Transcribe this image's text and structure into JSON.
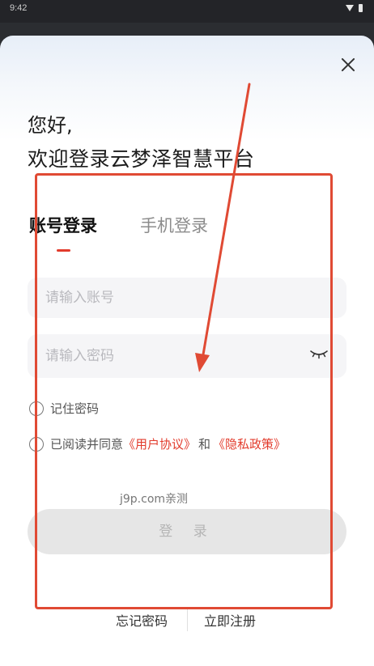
{
  "status_bar": {
    "time": "9:42"
  },
  "greeting": "您好,",
  "welcome_line": "欢迎登录云梦泽智慧平台",
  "tabs": [
    {
      "label": "账号登录",
      "active": true
    },
    {
      "label": "手机登录",
      "active": false
    }
  ],
  "account_input": {
    "placeholder": "请输入账号",
    "value": ""
  },
  "password_input": {
    "placeholder": "请输入密码",
    "value": ""
  },
  "remember_label": "记住密码",
  "agreement": {
    "prefix": "已阅读并同意",
    "user_agreement": "《用户协议》",
    "connector": "和",
    "privacy_policy": "《隐私政策》"
  },
  "watermark": "j9p.com亲测",
  "login_button": "登 录",
  "footer": {
    "forgot_label": "忘记密码",
    "register_label": "立即注册"
  },
  "colors": {
    "accent": "#e23b2c",
    "annotation": "#e04a34"
  },
  "icons": {
    "close": "close-icon",
    "password_visibility": "eye-closed-icon"
  }
}
